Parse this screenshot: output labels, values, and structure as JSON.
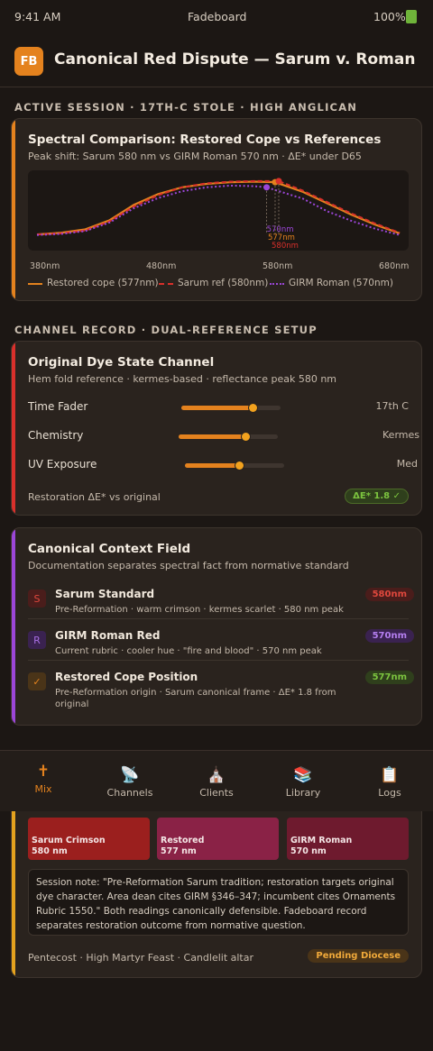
{
  "status_bar": {
    "time": "9:41 AM",
    "carrier": "Fadeboard",
    "battery": "100%",
    "battery_icon": "battery-icon"
  },
  "header": {
    "logo": "FB",
    "title": "Canonical Red Dispute — Sarum v. Roman"
  },
  "active_session": {
    "section_label": "ACTIVE SESSION · 17TH-C STOLE · HIGH ANGLICAN",
    "title": "Spectral Comparison: Restored Cope vs References",
    "subtitle": "Peak shift: Sarum 580 nm vs GIRM Roman 570 nm · ΔE* under D65"
  },
  "chart_data": {
    "type": "line",
    "title": "",
    "xlabel": "",
    "ylabel": "",
    "x_ticks": [
      "380nm",
      "480nm",
      "580nm",
      "680nm"
    ],
    "xlim": [
      380,
      680
    ],
    "ylim": [
      0,
      1
    ],
    "series": [
      {
        "name": "Restored cope (577nm)",
        "color": "#e4821e",
        "style": "solid",
        "x": [
          380,
          400,
          420,
          440,
          460,
          480,
          500,
          520,
          540,
          560,
          577,
          600,
          620,
          640,
          660,
          680
        ],
        "y": [
          0.03,
          0.06,
          0.12,
          0.28,
          0.55,
          0.74,
          0.86,
          0.92,
          0.95,
          0.96,
          0.95,
          0.78,
          0.58,
          0.38,
          0.2,
          0.05
        ]
      },
      {
        "name": "Sarum ref (580nm)",
        "color": "#d9302b",
        "style": "dashed",
        "x": [
          380,
          400,
          420,
          440,
          460,
          480,
          500,
          520,
          540,
          560,
          580,
          600,
          620,
          640,
          660,
          680
        ],
        "y": [
          0.03,
          0.05,
          0.1,
          0.26,
          0.52,
          0.72,
          0.86,
          0.93,
          0.96,
          0.97,
          0.97,
          0.8,
          0.6,
          0.4,
          0.22,
          0.06
        ]
      },
      {
        "name": "GIRM Roman (570nm)",
        "color": "#9b46d8",
        "style": "dotted",
        "x": [
          380,
          400,
          420,
          440,
          460,
          480,
          500,
          520,
          540,
          560,
          570,
          600,
          620,
          640,
          660,
          680
        ],
        "y": [
          0.02,
          0.04,
          0.09,
          0.24,
          0.49,
          0.67,
          0.79,
          0.86,
          0.89,
          0.88,
          0.86,
          0.66,
          0.44,
          0.27,
          0.13,
          0.02
        ]
      }
    ],
    "peak_labels": [
      {
        "label": "570nm",
        "x": 570,
        "color": "#9b46d8"
      },
      {
        "label": "577nm",
        "x": 577,
        "color": "#e4821e"
      },
      {
        "label": "580nm",
        "x": 580,
        "color": "#d9302b"
      }
    ],
    "grid": false,
    "legend_position": "bottom"
  },
  "channel_record": {
    "section_label": "CHANNEL RECORD · DUAL-REFERENCE SETUP",
    "title": "Original Dye State Channel",
    "subtitle": "Hem fold reference · kermes-based · reflectance peak 580 nm",
    "faders": [
      {
        "label": "Time Fader",
        "value": "17th C",
        "level": 0.72
      },
      {
        "label": "Chemistry",
        "value": "Kermes",
        "level": 0.68
      },
      {
        "label": "UV Exposure",
        "value": "Med",
        "level": 0.55
      }
    ],
    "delta_label": "Restoration ΔE* vs original",
    "delta_badge": "ΔE* 1.8 ✓"
  },
  "context_field": {
    "title": "Canonical Context Field",
    "subtitle": "Documentation separates spectral fact from normative standard",
    "items": [
      {
        "icon": "S",
        "title": "Sarum Standard",
        "desc": "Pre-Reformation · warm crimson · kermes scarlet · 580 nm peak",
        "badge": "580nm"
      },
      {
        "icon": "R",
        "title": "GIRM Roman Red",
        "desc": "Current rubric · cooler hue · \"fire and blood\" · 570 nm peak",
        "badge": "570nm"
      },
      {
        "icon": "✓",
        "title": "Restored Cope Position",
        "desc": "Pre-Reformation origin · Sarum canonical frame · ΔE* 1.8 from original",
        "badge": "577nm"
      }
    ]
  },
  "tab_bar": {
    "tabs": [
      {
        "icon": "🕇",
        "label": "Mix"
      },
      {
        "icon": "📡",
        "label": "Channels"
      },
      {
        "icon": "⛪",
        "label": "Clients"
      },
      {
        "icon": "📚",
        "label": "Library"
      },
      {
        "icon": "📋",
        "label": "Logs"
      }
    ],
    "active": "Mix"
  },
  "swatch_card": {
    "swatches": [
      {
        "name": "Sarum Crimson",
        "wl": "580 nm",
        "color": "#9b1f1e"
      },
      {
        "name": "Restored",
        "wl": "577 nm",
        "color": "#8a2246"
      },
      {
        "name": "GIRM Roman",
        "wl": "570 nm",
        "color": "#6e1a2e"
      }
    ],
    "note": "Session note: \"Pre-Reformation Sarum tradition; restoration targets original dye character. Area dean cites GIRM §346–347; incumbent cites Ornaments Rubric 1550.\" Both readings canonically defensible. Fadeboard record separates restoration outcome from normative question.",
    "footer": "Pentecost · High Martyr Feast · Candlelit altar",
    "status": "Pending Diocese"
  },
  "colors": {
    "accent": "#e4821e",
    "sarum": "#d9302b",
    "roman": "#9b46d8",
    "restored_ok": "#6fb43a"
  }
}
